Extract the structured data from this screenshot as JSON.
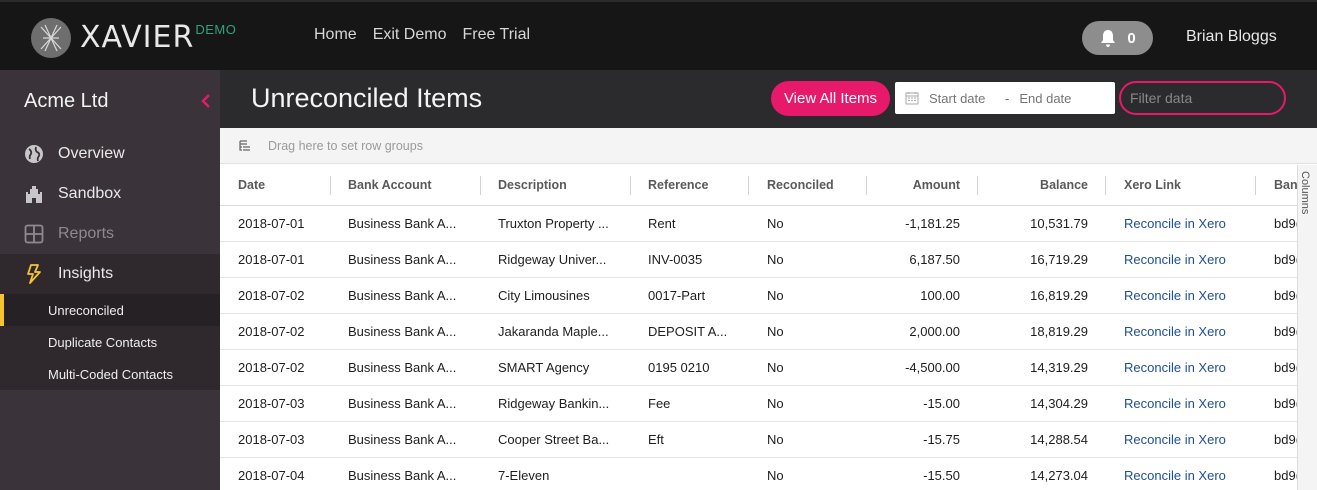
{
  "brand": {
    "name": "XAVIER",
    "suffix": "DEMO"
  },
  "topnav": {
    "items": [
      {
        "label": "Home"
      },
      {
        "label": "Exit Demo"
      },
      {
        "label": "Free Trial"
      }
    ]
  },
  "notifications": {
    "count": "0"
  },
  "user": {
    "name": "Brian Bloggs"
  },
  "sidebar": {
    "org": "Acme Ltd",
    "items": [
      {
        "label": "Overview",
        "icon": "globe-icon"
      },
      {
        "label": "Sandbox",
        "icon": "castle-icon"
      },
      {
        "label": "Reports",
        "icon": "grid-icon"
      },
      {
        "label": "Insights",
        "icon": "lightning-icon"
      }
    ],
    "subitems": [
      {
        "label": "Unreconciled"
      },
      {
        "label": "Duplicate Contacts"
      },
      {
        "label": "Multi-Coded Contacts"
      }
    ],
    "accent": "#f6c431"
  },
  "page": {
    "title": "Unreconciled Items",
    "view_all_label": "View All Items",
    "start_placeholder": "Start date",
    "date_separator": "-",
    "end_placeholder": "End date",
    "filter_placeholder": "Filter data",
    "accent": "#e7196b"
  },
  "grid": {
    "group_hint": "Drag here to set row groups",
    "columns_panel": "Columns",
    "columns": [
      "Date",
      "Bank Account",
      "Description",
      "Reference",
      "Reconciled",
      "Amount",
      "Balance",
      "Xero Link",
      "Ban"
    ],
    "rows": [
      [
        "2018-07-01",
        "Business Bank A...",
        "Truxton Property ...",
        "Rent",
        "No",
        "-1,181.25",
        "10,531.79",
        "Reconcile in Xero",
        "bd9("
      ],
      [
        "2018-07-01",
        "Business Bank A...",
        "Ridgeway Univer...",
        "INV-0035",
        "No",
        "6,187.50",
        "16,719.29",
        "Reconcile in Xero",
        "bd9("
      ],
      [
        "2018-07-02",
        "Business Bank A...",
        "City Limousines",
        "0017-Part",
        "No",
        "100.00",
        "16,819.29",
        "Reconcile in Xero",
        "bd9("
      ],
      [
        "2018-07-02",
        "Business Bank A...",
        "Jakaranda Maple...",
        "DEPOSIT A...",
        "No",
        "2,000.00",
        "18,819.29",
        "Reconcile in Xero",
        "bd9("
      ],
      [
        "2018-07-02",
        "Business Bank A...",
        "SMART Agency",
        "0195 0210",
        "No",
        "-4,500.00",
        "14,319.29",
        "Reconcile in Xero",
        "bd9("
      ],
      [
        "2018-07-03",
        "Business Bank A...",
        "Ridgeway Bankin...",
        "Fee",
        "No",
        "-15.00",
        "14,304.29",
        "Reconcile in Xero",
        "bd9("
      ],
      [
        "2018-07-03",
        "Business Bank A...",
        "Cooper Street Ba...",
        "Eft",
        "No",
        "-15.75",
        "14,288.54",
        "Reconcile in Xero",
        "bd9("
      ],
      [
        "2018-07-04",
        "Business Bank A...",
        "7-Eleven",
        "",
        "No",
        "-15.50",
        "14,273.04",
        "Reconcile in Xero",
        "bd9("
      ]
    ],
    "link_color": "#1f4e9c"
  }
}
